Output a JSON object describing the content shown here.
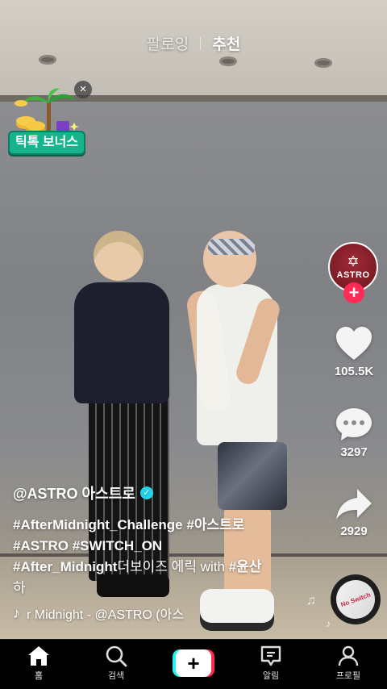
{
  "top_tabs": {
    "following": "팔로잉",
    "for_you": "추천"
  },
  "bonus": {
    "label": "틱톡 보너스",
    "close": "×"
  },
  "creator": {
    "avatar_text": "ASTRO",
    "avatar_logo": "✡",
    "follow": "+"
  },
  "actions": {
    "likes": "105.5K",
    "comments": "3297",
    "shares": "2929"
  },
  "caption": {
    "author": "@ASTRO 아스트로",
    "verified": "✓",
    "line1_tag1": "#AfterMidnight_Challenge",
    "line1_tag2": "#아스트로",
    "line2_tag1": "#ASTRO",
    "line2_tag2": "#SWITCH_ON",
    "line3_tag": "#After_Midnight",
    "line3_text": "더보이즈 에릭 with ",
    "line3_tag2": "#윤산",
    "line4_text": "하"
  },
  "music": {
    "icon": "♪",
    "text": "r Midnight - @ASTRO (아스"
  },
  "disc": {
    "label": "No Switch"
  },
  "nav": {
    "home": "홈",
    "search": "검색",
    "create": "+",
    "inbox": "알림",
    "profile": "프로필"
  },
  "colors": {
    "accent_red": "#fe2c55",
    "accent_cyan": "#25f4ee",
    "bonus_green": "#17b38c",
    "verified_blue": "#20d5ec"
  }
}
